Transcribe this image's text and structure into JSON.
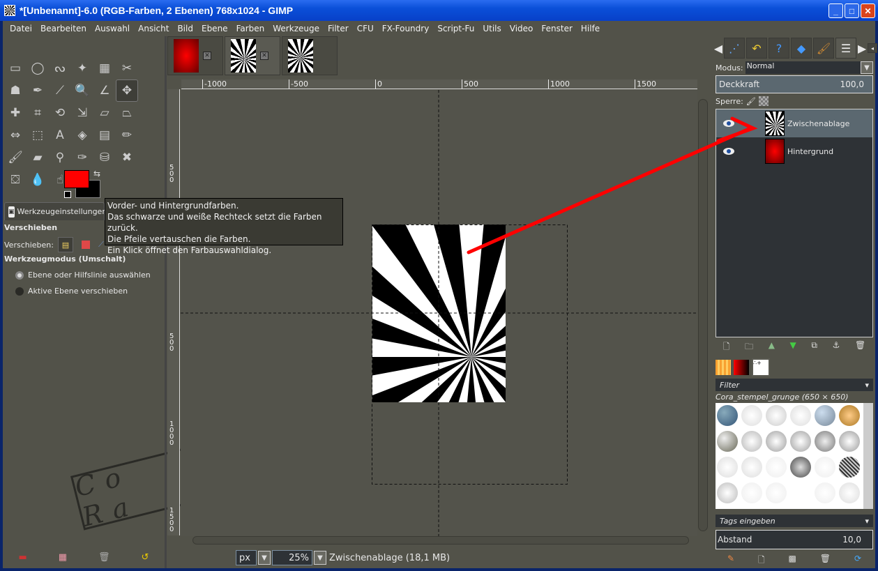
{
  "window": {
    "title": "*[Unbenannt]-6.0 (RGB-Farben, 2 Ebenen) 768x1024 - GIMP",
    "minimize": "_",
    "maximize": "□",
    "close": "✕"
  },
  "menu": [
    "Datei",
    "Bearbeiten",
    "Auswahl",
    "Ansicht",
    "Bild",
    "Ebene",
    "Farben",
    "Werkzeuge",
    "Filter",
    "CFU",
    "FX-Foundry",
    "Script-Fu",
    "Utils",
    "Video",
    "Fenster",
    "Hilfe"
  ],
  "toolbox": {
    "tools": [
      {
        "name": "rect-select-icon",
        "glyph": "▭"
      },
      {
        "name": "ellipse-select-icon",
        "glyph": "◯"
      },
      {
        "name": "lasso-icon",
        "glyph": "ᔓ"
      },
      {
        "name": "fuzzy-select-icon",
        "glyph": "✦"
      },
      {
        "name": "color-select-icon",
        "glyph": "▦"
      },
      {
        "name": "scissors-icon",
        "glyph": "✂"
      },
      {
        "name": "foreground-select-icon",
        "glyph": "☗"
      },
      {
        "name": "paths-icon",
        "glyph": "✒"
      },
      {
        "name": "color-picker-icon",
        "glyph": "⟋"
      },
      {
        "name": "zoom-icon",
        "glyph": "🔍"
      },
      {
        "name": "measure-icon",
        "glyph": "∠"
      },
      {
        "name": "move-icon",
        "glyph": "✥"
      },
      {
        "name": "align-icon",
        "glyph": "✚"
      },
      {
        "name": "crop-icon",
        "glyph": "⌗"
      },
      {
        "name": "rotate-icon",
        "glyph": "⟲"
      },
      {
        "name": "scale-icon",
        "glyph": "⇲"
      },
      {
        "name": "shear-icon",
        "glyph": "▱"
      },
      {
        "name": "perspective-icon",
        "glyph": "⏢"
      },
      {
        "name": "flip-icon",
        "glyph": "⇔"
      },
      {
        "name": "cage-icon",
        "glyph": "⬚"
      },
      {
        "name": "text-icon",
        "glyph": "A"
      },
      {
        "name": "bucket-fill-icon",
        "glyph": "◈"
      },
      {
        "name": "gradient-icon",
        "glyph": "▤"
      },
      {
        "name": "pencil-icon",
        "glyph": "✏"
      },
      {
        "name": "paintbrush-icon",
        "glyph": "🖌"
      },
      {
        "name": "eraser-icon",
        "glyph": "▰"
      },
      {
        "name": "airbrush-icon",
        "glyph": "⚲"
      },
      {
        "name": "ink-icon",
        "glyph": "✑"
      },
      {
        "name": "clone-icon",
        "glyph": "⛁"
      },
      {
        "name": "heal-icon",
        "glyph": "✖"
      },
      {
        "name": "perspective-clone-icon",
        "glyph": "⛋"
      },
      {
        "name": "blur-icon",
        "glyph": "💧"
      },
      {
        "name": "smudge-icon",
        "glyph": "☝"
      },
      {
        "name": "dodge-burn-icon",
        "glyph": "◔"
      }
    ],
    "active_tool": 11,
    "fg_color": "#ff0000",
    "bg_color": "#000000",
    "options_tab": "Werkzeugeinstellungen",
    "tool_name": "Verschieben",
    "move_label": "Verschieben:",
    "mode_title": "Werkzeugmodus (Umschalt)",
    "modes": [
      "Ebene oder Hilfslinie auswählen",
      "Aktive Ebene verschieben"
    ],
    "stamp": "Co Ra"
  },
  "tooltip": [
    "Vorder- und Hintergrundfarben.",
    "Das schwarze und weiße Rechteck setzt die Farben zurück.",
    "Die Pfeile vertauschen die Farben.",
    "Ein Klick öffnet den Farbauswahldialog."
  ],
  "image_tabs": [
    {
      "close": "✕"
    },
    {
      "close": "✕"
    },
    {
      "close": ""
    }
  ],
  "rulers": {
    "h": [
      "-1000",
      "-500",
      "0",
      "500",
      "1000",
      "1500"
    ],
    "v": [
      "500",
      "0",
      "500",
      "1000",
      "1500"
    ]
  },
  "statusbar": {
    "unit": "px",
    "zoom": "25%",
    "info": "Zwischenablage (18,1 MB)"
  },
  "layers_panel": {
    "mode_label": "Modus:",
    "mode_value": "Normal",
    "opacity_label": "Deckkraft",
    "opacity_value": "100,0",
    "lock_label": "Sperre:",
    "layers": [
      {
        "name": "Zwischenablage",
        "selected": true
      },
      {
        "name": "Hintergrund",
        "selected": false
      }
    ]
  },
  "brushes_panel": {
    "filter": "Filter",
    "brush_name": "Cora_stempel_grunge (650 × 650)",
    "tags_placeholder": "Tags eingeben",
    "spacing_label": "Abstand",
    "spacing_value": "10,0"
  },
  "colors": {
    "accent_red": "#ff0000",
    "panel_bg": "#525249",
    "selection": "#5b6870"
  }
}
